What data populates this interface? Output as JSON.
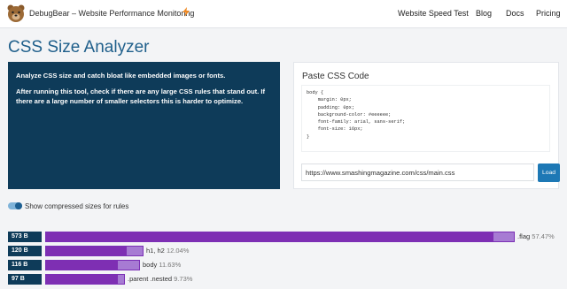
{
  "header": {
    "brand": "DebugBear – Website Performance Monitoring",
    "nav": [
      "Website Speed Test",
      "Blog",
      "Docs",
      "Pricing"
    ]
  },
  "page_title": "CSS Size Analyzer",
  "intro": {
    "p1": "Analyze CSS size and catch bloat like embedded images or fonts.",
    "p2": "After running this tool, check if there are any large CSS rules that stand out. If there are a large number of smaller selectors this is harder to optimize."
  },
  "css_panel": {
    "title": "Paste CSS Code",
    "code": "body {\n    margin: 0px;\n    padding: 0px;\n    background-color: #eeeeee;\n    font-family: arial, sans-serif;\n    font-size: 16px;\n}",
    "url_value": "https://www.smashingmagazine.com/css/main.css",
    "load_label": "Load"
  },
  "toggle": {
    "label": "Show compressed sizes for rules",
    "on": true
  },
  "rules": [
    {
      "size": "573 B",
      "selector": ".flag",
      "percent": "57.47%",
      "share": 0.5747,
      "compressed_share": 0.55
    },
    {
      "size": "120 B",
      "selector": "h1, h2",
      "percent": "12.04%",
      "share": 0.1204,
      "compressed_share": 0.1
    },
    {
      "size": "116 B",
      "selector": "body",
      "percent": "11.63%",
      "share": 0.1163,
      "compressed_share": 0.09
    },
    {
      "size": "97 B",
      "selector": ".parent .nested",
      "percent": "9.73%",
      "share": 0.0973,
      "compressed_share": 0.09
    }
  ],
  "colors": {
    "accent": "#1f5f8b",
    "panel": "#0e3b59",
    "bar_dark": "#7e2fb3",
    "bar_light": "#a77bd3",
    "bolt": "#f08a24"
  }
}
